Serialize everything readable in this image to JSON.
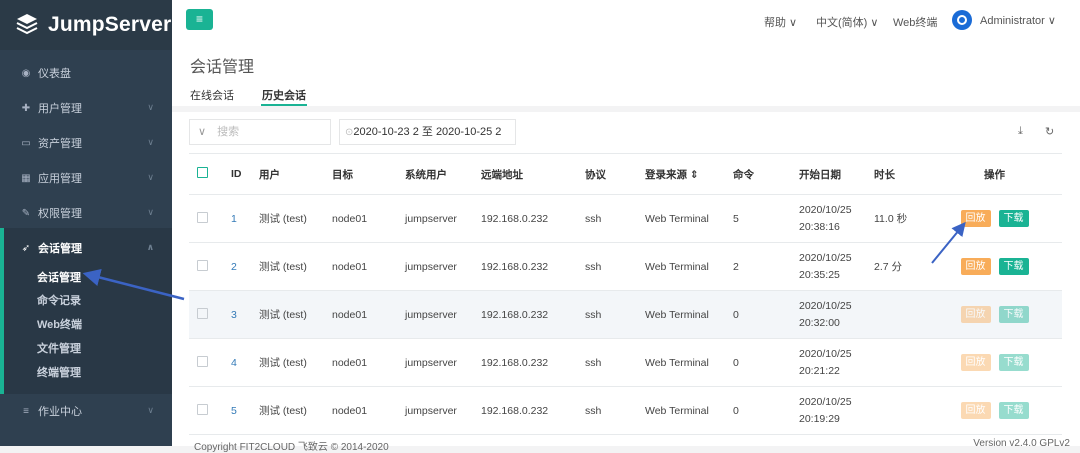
{
  "app": {
    "name": "JumpServer"
  },
  "sidebar": {
    "items": [
      {
        "label": "仪表盘",
        "icon": "dashboard-icon",
        "glyph": "◉"
      },
      {
        "label": "用户管理",
        "icon": "users-icon",
        "glyph": "✚"
      },
      {
        "label": "资产管理",
        "icon": "inbox-icon",
        "glyph": "▭"
      },
      {
        "label": "应用管理",
        "icon": "grid-icon",
        "glyph": "▦"
      },
      {
        "label": "权限管理",
        "icon": "edit-icon",
        "glyph": "✎"
      },
      {
        "label": "会话管理",
        "icon": "rocket-icon",
        "glyph": "➶"
      },
      {
        "label": "作业中心",
        "icon": "list-icon",
        "glyph": "≡"
      }
    ],
    "submenu": [
      {
        "label": "会话管理"
      },
      {
        "label": "命令记录"
      },
      {
        "label": "Web终端"
      },
      {
        "label": "文件管理"
      },
      {
        "label": "终端管理"
      }
    ]
  },
  "topbar": {
    "menu_glyph": "≡",
    "help": "帮助 ∨",
    "lang": "中文(简体) ∨",
    "webterm": "Web终端",
    "user": "Administrator ∨"
  },
  "page": {
    "title": "会话管理",
    "tabs": [
      {
        "label": "在线会话"
      },
      {
        "label": "历史会话"
      }
    ]
  },
  "toolbar": {
    "search_placeholder": "搜索",
    "search_chevron": "∨",
    "date_range": "2020-10-23 2 至 2020-10-25 2",
    "date_icon": "⊙",
    "download_glyph": "⤓",
    "refresh_glyph": "↻"
  },
  "table": {
    "columns": [
      "ID",
      "用户",
      "目标",
      "系统用户",
      "远端地址",
      "协议",
      "登录来源 ⇕",
      "命令",
      "开始日期",
      "时长",
      "操作"
    ],
    "rows": [
      {
        "id": "1",
        "user": "测试 (test)",
        "target": "node01",
        "sysuser": "jumpserver",
        "addr": "192.168.0.232",
        "proto": "ssh",
        "source": "Web Terminal",
        "cmds": "5",
        "date1": "2020/10/25",
        "date2": "20:38:16",
        "duration": "11.0 秒",
        "replay": "回放",
        "download": "下载"
      },
      {
        "id": "2",
        "user": "测试 (test)",
        "target": "node01",
        "sysuser": "jumpserver",
        "addr": "192.168.0.232",
        "proto": "ssh",
        "source": "Web Terminal",
        "cmds": "2",
        "date1": "2020/10/25",
        "date2": "20:35:25",
        "duration": "2.7 分",
        "replay": "回放",
        "download": "下载"
      },
      {
        "id": "3",
        "user": "测试 (test)",
        "target": "node01",
        "sysuser": "jumpserver",
        "addr": "192.168.0.232",
        "proto": "ssh",
        "source": "Web Terminal",
        "cmds": "0",
        "date1": "2020/10/25",
        "date2": "20:32:00",
        "duration": "",
        "replay": "回放",
        "download": "下载"
      },
      {
        "id": "4",
        "user": "测试 (test)",
        "target": "node01",
        "sysuser": "jumpserver",
        "addr": "192.168.0.232",
        "proto": "ssh",
        "source": "Web Terminal",
        "cmds": "0",
        "date1": "2020/10/25",
        "date2": "20:21:22",
        "duration": "",
        "replay": "回放",
        "download": "下载"
      },
      {
        "id": "5",
        "user": "测试 (test)",
        "target": "node01",
        "sysuser": "jumpserver",
        "addr": "192.168.0.232",
        "proto": "ssh",
        "source": "Web Terminal",
        "cmds": "0",
        "date1": "2020/10/25",
        "date2": "20:19:29",
        "duration": "",
        "replay": "回放",
        "download": "下载"
      }
    ]
  },
  "footer": {
    "left": "Copyright FIT2CLOUD 飞致云 © 2014-2020",
    "right": "Version v2.4.0 GPLv2"
  },
  "colors": {
    "accent": "#1ab394",
    "sidebar": "#2f4050",
    "replay": "#f8ac59",
    "annotation_arrow": "#3b63c4"
  }
}
